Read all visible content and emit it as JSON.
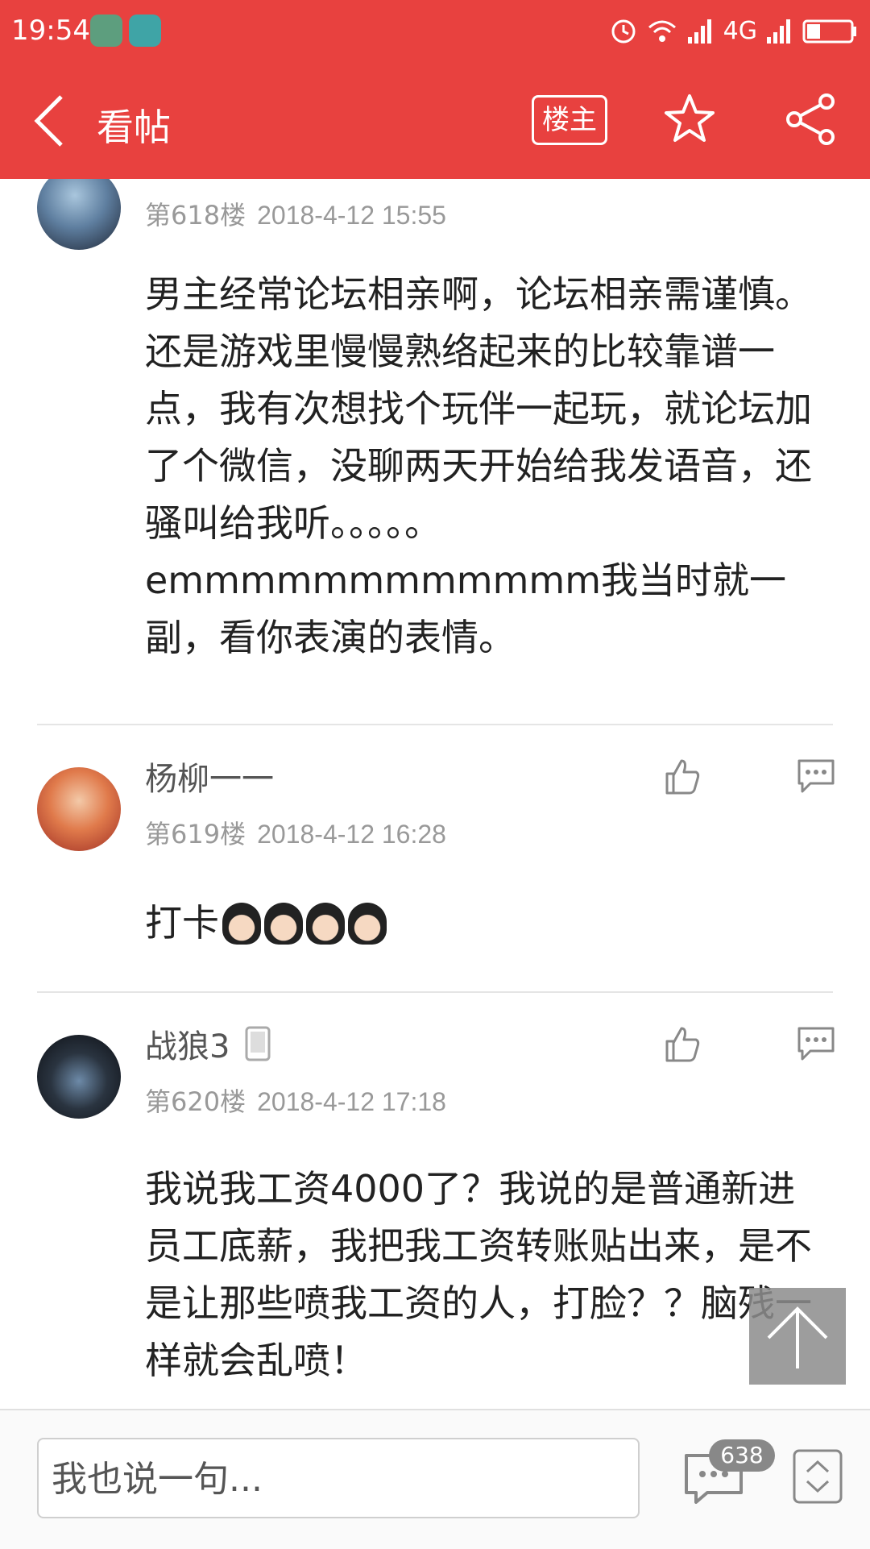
{
  "status": {
    "time": "19:54",
    "network": "4G"
  },
  "header": {
    "title": "看帖",
    "owner_label": "楼主"
  },
  "posts": [
    {
      "username": "",
      "floor": "第618楼",
      "date": "2018-4-12 15:55",
      "text": "男主经常论坛相亲啊，论坛相亲需谨慎。还是游戏里慢慢熟络起来的比较靠谱一点，我有次想找个玩伴一起玩，就论坛加了个微信，没聊两天开始给我发语音，还骚叫给我听。。。。。emmmmmmmmmmmm我当时就一副，看你表演的表情。"
    },
    {
      "username": "杨柳一一",
      "floor": "第619楼",
      "date": "2018-4-12 16:28",
      "text": "打卡"
    },
    {
      "username": "战狼3",
      "floor": "第620楼",
      "date": "2018-4-12 17:18",
      "text": "我说我工资4000了？我说的是普通新进员工底薪，我把我工资转账贴出来，是不是让那些喷我工资的人，打脸？？脑残一样就会乱喷！"
    }
  ],
  "composer": {
    "placeholder": "我也说一句...",
    "comment_count": "638"
  },
  "colors": {
    "brand": "#e8413f"
  }
}
